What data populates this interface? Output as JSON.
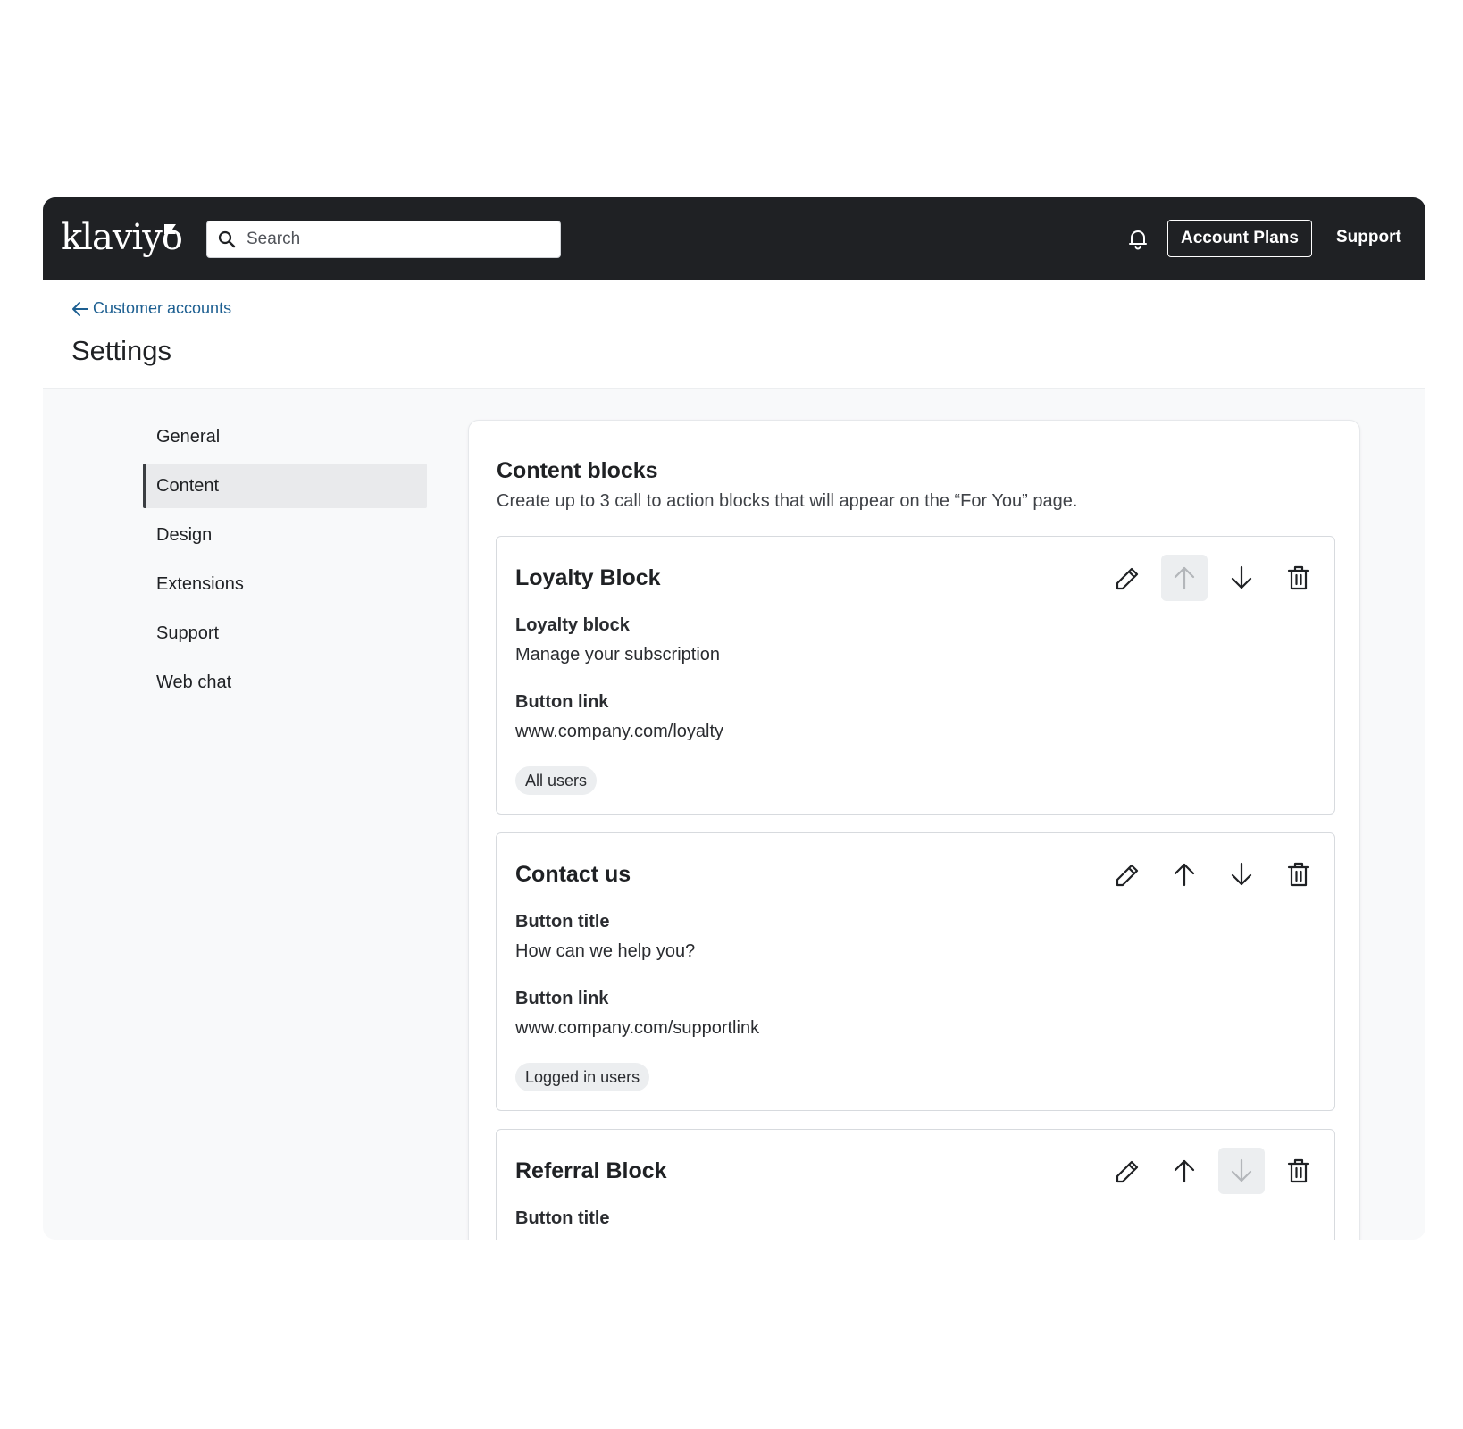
{
  "brand": {
    "logo_text": "klaviyo"
  },
  "topbar": {
    "search_placeholder": "Search",
    "account_button": "Account Plans",
    "support_link": "Support"
  },
  "header": {
    "back_label": "Customer accounts",
    "title": "Settings"
  },
  "sidebar": {
    "items": [
      {
        "label": "General",
        "active": false
      },
      {
        "label": "Content",
        "active": true
      },
      {
        "label": "Design",
        "active": false
      },
      {
        "label": "Extensions",
        "active": false
      },
      {
        "label": "Support",
        "active": false
      },
      {
        "label": "Web chat",
        "active": false
      }
    ]
  },
  "content": {
    "title": "Content blocks",
    "description": "Create up to 3 call to action blocks that will appear on the “For You” page.",
    "blocks": [
      {
        "name": "Loyalty Block",
        "field1_label": "Loyalty block",
        "field1_value": "Manage your subscription",
        "field2_label": "Button link",
        "field2_value": "www.company.com/loyalty",
        "audience": "All users",
        "up_disabled": true,
        "down_disabled": false
      },
      {
        "name": "Contact us",
        "field1_label": "Button title",
        "field1_value": "How can we help you?",
        "field2_label": "Button link",
        "field2_value": "www.company.com/supportlink",
        "audience": "Logged in users",
        "up_disabled": false,
        "down_disabled": false
      },
      {
        "name": "Referral Block",
        "field1_label": "Button title",
        "up_disabled": false,
        "down_disabled": true
      }
    ]
  },
  "colors": {
    "topbar_bg": "#1f2124",
    "link": "#1d5f91",
    "disabled_icon": "#b3b6ba"
  }
}
